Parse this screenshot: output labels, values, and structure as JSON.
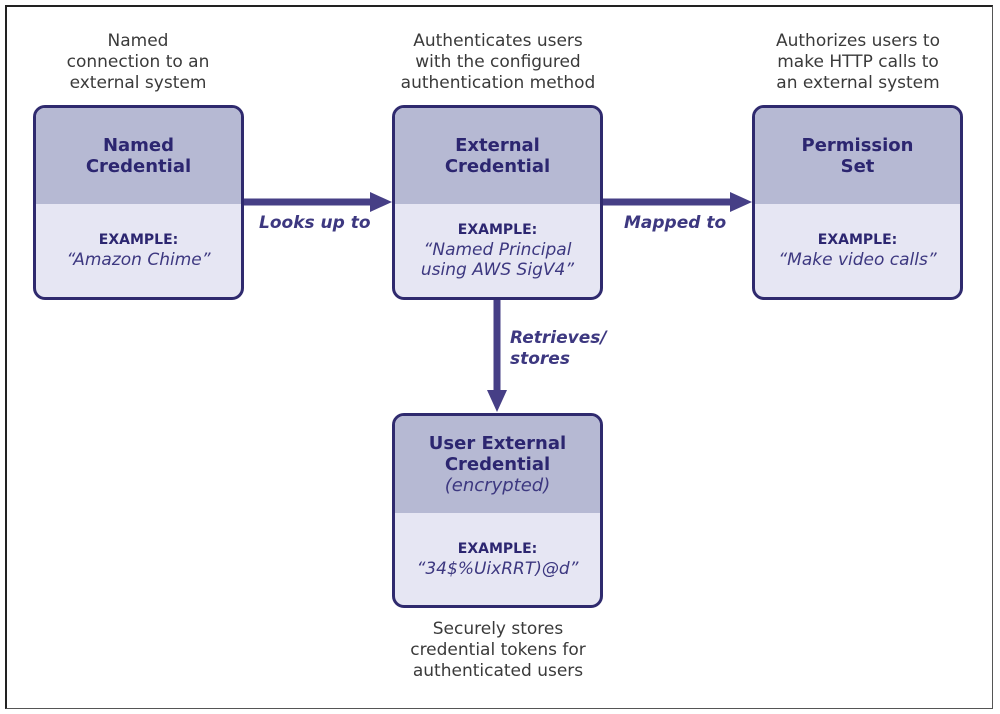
{
  "nodes": {
    "named_credential": {
      "description": [
        "Named",
        "connection to an",
        "external system"
      ],
      "title": [
        "Named",
        "Credential"
      ],
      "example_label": "EXAMPLE:",
      "example_value": "“Amazon Chime”"
    },
    "external_credential": {
      "description": [
        "Authenticates users",
        "with the configured",
        "authentication method"
      ],
      "title": [
        "External",
        "Credential"
      ],
      "example_label": "EXAMPLE:",
      "example_value": [
        "“Named Principal",
        "using AWS SigV4”"
      ]
    },
    "permission_set": {
      "description": [
        "Authorizes users to",
        "make HTTP calls to",
        "an external system"
      ],
      "title": [
        "Permission",
        "Set"
      ],
      "example_label": "EXAMPLE:",
      "example_value": "“Make video calls”"
    },
    "user_external_credential": {
      "title": [
        "User External",
        "Credential"
      ],
      "subtitle": "(encrypted)",
      "example_label": "EXAMPLE:",
      "example_value": "“34$%UixRRT)@d”",
      "description": [
        "Securely stores",
        "credential tokens for",
        "authenticated users"
      ]
    }
  },
  "edges": {
    "looks_up_to": "Looks up to",
    "mapped_to": "Mapped to",
    "retrieves_stores": [
      "Retrieves/",
      "stores"
    ]
  },
  "colors": {
    "header_fill": "#b6b9d3",
    "body_fill": "#e6e6f3",
    "border": "#2f2a6e",
    "arrow": "#463f86"
  }
}
